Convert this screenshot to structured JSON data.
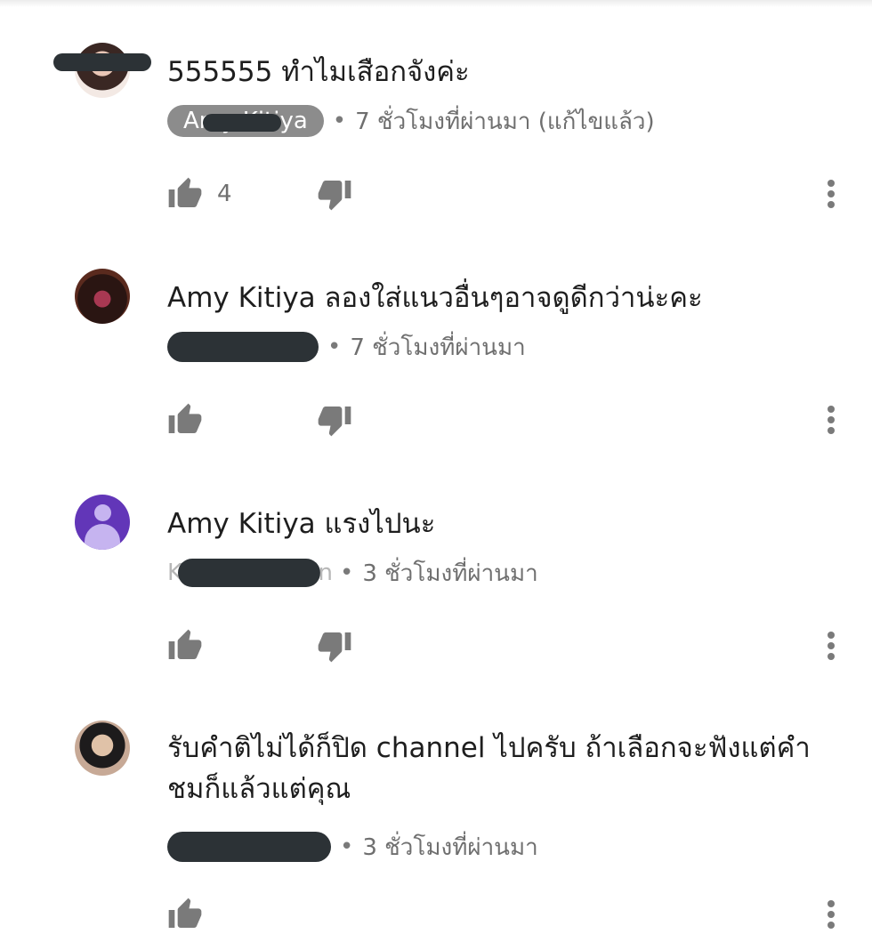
{
  "comments": [
    {
      "text": "555555 ทำไมเสือกจังค่ะ",
      "author_chip": "Amy Kitiya",
      "time": "7 ชั่วโมงที่ผ่านมา (แก้ไขแล้ว)",
      "likes": "4"
    },
    {
      "text": "Amy Kitiya ลองใส่แนวอื่นๆอาจดูดีกว่าน่ะคะ",
      "time": "7 ชั่วโมงที่ผ่านมา",
      "likes": ""
    },
    {
      "text": "Amy Kitiya  แรงไปนะ",
      "author_fragment_left": "K",
      "author_fragment_right": "n",
      "time": "3 ชั่วโมงที่ผ่านมา",
      "likes": ""
    },
    {
      "text": "รับคำติไม่ได้ก็ปิด channel ไปครับ  ถ้าเลือกจะฟังแต่คำชมก็แล้วแต่คุณ",
      "time": "3 ชั่วโมงที่ผ่านมา",
      "likes": ""
    }
  ],
  "separator": "•",
  "icons": {
    "like": "thumbs-up-icon",
    "dislike": "thumbs-down-icon",
    "more": "more-vert-icon"
  },
  "colors": {
    "icon": "#7a7a7a",
    "chip_bg": "#8c8c8c",
    "redaction": "#2c3236",
    "default_avatar": "#6236b8"
  }
}
